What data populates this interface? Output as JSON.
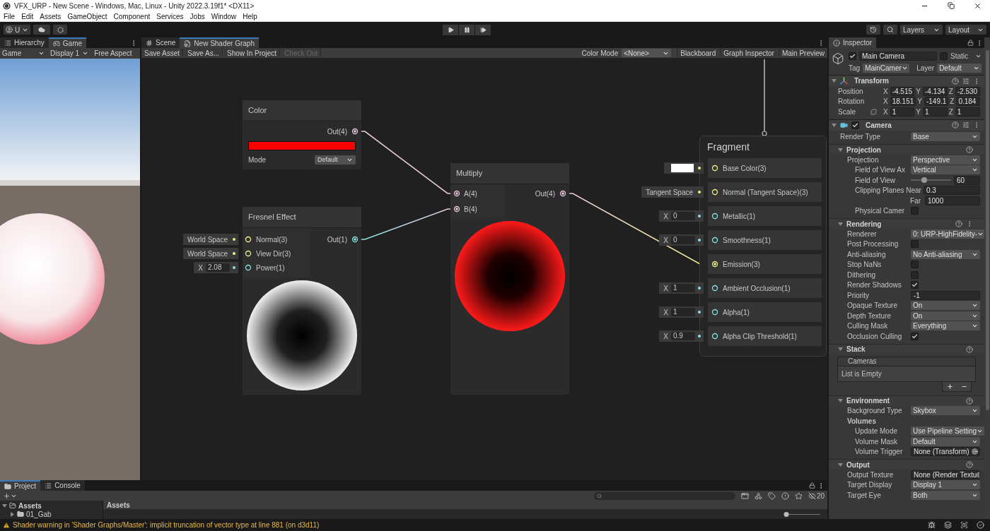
{
  "window": {
    "title": "VFX_URP - New Scene - Windows, Mac, Linux - Unity 2022.3.19f1* <DX11>"
  },
  "menu": [
    "File",
    "Edit",
    "Assets",
    "GameObject",
    "Component",
    "Services",
    "Jobs",
    "Window",
    "Help"
  ],
  "toolbar": {
    "account": "U",
    "layers": "Layers",
    "layout": "Layout"
  },
  "game_panel": {
    "tabs": [
      {
        "label": "Hierarchy",
        "selected": false
      },
      {
        "label": "Game",
        "selected": true
      }
    ],
    "controls": [
      {
        "label": "Game",
        "dropdown": true
      },
      {
        "label": "Display 1",
        "dropdown": true
      },
      {
        "label": "Free Aspect",
        "dropdown": false
      }
    ]
  },
  "graph_panel": {
    "tabs": [
      {
        "label": "Scene",
        "selected": false
      },
      {
        "label": "New Shader Graph",
        "selected": true
      }
    ],
    "buttons": [
      {
        "label": "Save Asset",
        "disabled": false
      },
      {
        "label": "Save As...",
        "disabled": false
      },
      {
        "label": "Show In Project",
        "disabled": false
      },
      {
        "label": "Check Out",
        "disabled": true
      }
    ],
    "color_mode": {
      "label": "Color Mode",
      "value": "<None>"
    },
    "toggles": [
      "Blackboard",
      "Graph Inspector",
      "Main Preview"
    ]
  },
  "graph": {
    "color_node": {
      "title": "Color",
      "output": {
        "label": "Out(4)",
        "color": "#e9c8dc"
      },
      "swatch": {
        "color": "#ff0000"
      },
      "mode_label": "Mode",
      "mode": "Default"
    },
    "fresnel_node": {
      "title": "Fresnel Effect",
      "inputs": [
        {
          "label": "Normal(3)",
          "kind": "space",
          "value": "World Space",
          "color": "#f3f08a"
        },
        {
          "label": "View Dir(3)",
          "kind": "space",
          "value": "World Space",
          "color": "#f3f08a"
        },
        {
          "label": "Power(1)",
          "kind": "float",
          "axis": "X",
          "value": "2.08",
          "color": "#84e4e7"
        }
      ],
      "output": {
        "label": "Out(1)",
        "color": "#84e4e7"
      }
    },
    "multiply_node": {
      "title": "Multiply",
      "inputs": [
        {
          "label": "A(4)",
          "color": "#e9c8dc",
          "connected": true
        },
        {
          "label": "B(4)",
          "color": "#e9c8dc",
          "connected": true
        }
      ],
      "output": {
        "label": "Out(4)",
        "color": "#e9c8dc"
      }
    },
    "fragment_node": {
      "title": "Fragment",
      "ports": [
        {
          "label": "Base Color(3)",
          "kind": "color",
          "swatch": {
            "color": "#ffffff"
          },
          "color": "#f3f08a"
        },
        {
          "label": "Normal (Tangent Space)(3)",
          "kind": "space",
          "value": "Tangent Space",
          "color": "#f3f08a"
        },
        {
          "label": "Metallic(1)",
          "kind": "float",
          "axis": "X",
          "value": "0",
          "color": "#84e4e7"
        },
        {
          "label": "Smoothness(1)",
          "kind": "float",
          "axis": "X",
          "value": "0",
          "color": "#84e4e7"
        },
        {
          "label": "Emission(3)",
          "kind": "connected",
          "color": "#f3f08a"
        },
        {
          "label": "Ambient Occlusion(1)",
          "kind": "float",
          "axis": "X",
          "value": "1",
          "color": "#84e4e7"
        },
        {
          "label": "Alpha(1)",
          "kind": "float",
          "axis": "X",
          "value": "1",
          "color": "#84e4e7"
        },
        {
          "label": "Alpha Clip Threshold(1)",
          "kind": "float",
          "axis": "X",
          "value": "0.9",
          "color": "#84e4e7"
        }
      ]
    }
  },
  "inspector": {
    "tab": "Inspector",
    "object": {
      "enabled": true,
      "name": "Main Camera",
      "static": false,
      "static_label": "Static",
      "tag_label": "Tag",
      "tag": "MainCamer",
      "layer_label": "Layer",
      "layer": "Default"
    },
    "transform": {
      "title": "Transform",
      "rows": [
        {
          "kind": "vector",
          "label": "Position",
          "values": [
            {
              "axis": "X",
              "value": "-4.515"
            },
            {
              "axis": "Y",
              "value": "-4.134"
            },
            {
              "axis": "Z",
              "value": "-2.530"
            }
          ]
        },
        {
          "kind": "vector",
          "label": "Rotation",
          "values": [
            {
              "axis": "X",
              "value": "18.151"
            },
            {
              "axis": "Y",
              "value": "-149.1"
            },
            {
              "axis": "Z",
              "value": "0.184"
            }
          ]
        },
        {
          "kind": "scale",
          "label": "Scale",
          "values": [
            {
              "axis": "X",
              "value": "1"
            },
            {
              "axis": "Y",
              "value": "1"
            },
            {
              "axis": "Z",
              "value": "1"
            }
          ]
        }
      ]
    },
    "camera": {
      "title": "Camera",
      "enabled": true,
      "rows": [
        {
          "kind": "dropdown",
          "label": "Render Type",
          "value": "Base"
        }
      ],
      "sections": [
        {
          "title": "Projection",
          "expanded": true,
          "menu": false,
          "rows": [
            {
              "kind": "dropdown",
              "label": "Projection",
              "value": "Perspective",
              "children": [
                {
                  "kind": "dropdown",
                  "label": "Field of View Ax",
                  "value": "Vertical"
                },
                {
                  "kind": "slider",
                  "label": "Field of View",
                  "value": "60",
                  "level": 0.33
                },
                {
                  "kind": "field",
                  "label": "Clipping Planes Near",
                  "value": "0.3"
                },
                {
                  "kind": "subfield",
                  "label": "Far",
                  "value": "1000"
                },
                {
                  "kind": "checkbox",
                  "label": "Physical Camer",
                  "checked": false
                }
              ]
            }
          ]
        },
        {
          "title": "Rendering",
          "expanded": true,
          "menu": true,
          "rows": [
            {
              "kind": "dropdown",
              "label": "Renderer",
              "value": "0: URP-HighFidelity-"
            },
            {
              "kind": "checkbox",
              "label": "Post Processing",
              "checked": false
            },
            {
              "kind": "dropdown",
              "label": "Anti-aliasing",
              "value": "No Anti-aliasing"
            },
            {
              "kind": "checkbox",
              "label": "Stop NaNs",
              "checked": false
            },
            {
              "kind": "checkbox",
              "label": "Dithering",
              "checked": false
            },
            {
              "kind": "checkbox",
              "label": "Render Shadows",
              "checked": true
            },
            {
              "kind": "field",
              "label": "Priority",
              "value": "-1"
            },
            {
              "kind": "dropdown",
              "label": "Opaque Texture",
              "value": "On"
            },
            {
              "kind": "dropdown",
              "label": "Depth Texture",
              "value": "On"
            },
            {
              "kind": "dropdown",
              "label": "Culling Mask",
              "value": "Everything"
            },
            {
              "kind": "checkbox",
              "label": "Occlusion Culling",
              "checked": true
            }
          ]
        },
        {
          "title": "Stack",
          "expanded": true,
          "menu": false,
          "list": {
            "header": "Cameras",
            "empty": "List is Empty"
          }
        },
        {
          "title": "Environment",
          "expanded": true,
          "menu": false,
          "rows": [
            {
              "kind": "dropdown",
              "label": "Background Type",
              "value": "Skybox"
            },
            {
              "kind": "label",
              "label": "Volumes",
              "children": [
                {
                  "kind": "dropdown",
                  "label": "Update Mode",
                  "value": "Use Pipeline Setting"
                },
                {
                  "kind": "dropdown",
                  "label": "Volume Mask",
                  "value": "Default"
                },
                {
                  "kind": "object",
                  "label": "Volume Trigger",
                  "value": "None (Transform)"
                }
              ]
            }
          ]
        },
        {
          "title": "Output",
          "expanded": true,
          "menu": false,
          "rows": [
            {
              "kind": "object",
              "label": "Output Texture",
              "value": "None (Render Textu"
            },
            {
              "kind": "dropdown",
              "label": "Target Display",
              "value": "Display 1"
            },
            {
              "kind": "dropdown",
              "label": "Target Eye",
              "value": "Both"
            }
          ]
        }
      ]
    }
  },
  "project_panel": {
    "tabs": [
      {
        "label": "Project",
        "selected": true
      },
      {
        "label": "Console",
        "selected": false
      }
    ],
    "hidden_count": "20",
    "tree": [
      {
        "label": "Assets",
        "expanded": true,
        "children": [
          {
            "label": "01_Gab",
            "expanded": false
          }
        ]
      }
    ],
    "content_header": "Assets",
    "zoom": {
      "level": 0
    }
  },
  "status_bar": {
    "message": "Shader warning in 'Shader Graphs/Master': implicit truncation of vector type at line 881 (on d3d11)"
  }
}
